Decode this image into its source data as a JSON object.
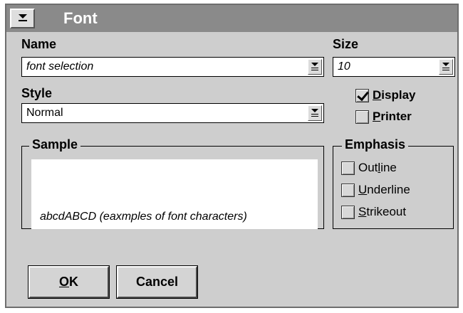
{
  "dialog": {
    "title": "Font",
    "system_menu_icon": "system-menu-icon"
  },
  "name_field": {
    "label": "Name",
    "value": "font selection"
  },
  "size_field": {
    "label": "Size",
    "value": "10"
  },
  "style_field": {
    "label": "Style",
    "value": "Normal"
  },
  "target": {
    "display": {
      "pre": "",
      "mn": "D",
      "post": "isplay",
      "checked": true
    },
    "printer": {
      "pre": "",
      "mn": "P",
      "post": "rinter",
      "checked": false
    }
  },
  "sample": {
    "label": "Sample",
    "text": "abcdABCD   (eaxmples of font characters)"
  },
  "emphasis": {
    "label": "Emphasis",
    "outline": {
      "pre": "Out",
      "mn": "l",
      "post": "ine",
      "checked": false
    },
    "underline": {
      "pre": "",
      "mn": "U",
      "post": "nderline",
      "checked": false
    },
    "strikeout": {
      "pre": "",
      "mn": "S",
      "post": "trikeout",
      "checked": false
    }
  },
  "buttons": {
    "ok": {
      "pre": "",
      "mn": "O",
      "post": "K"
    },
    "cancel": {
      "label": "Cancel"
    }
  }
}
